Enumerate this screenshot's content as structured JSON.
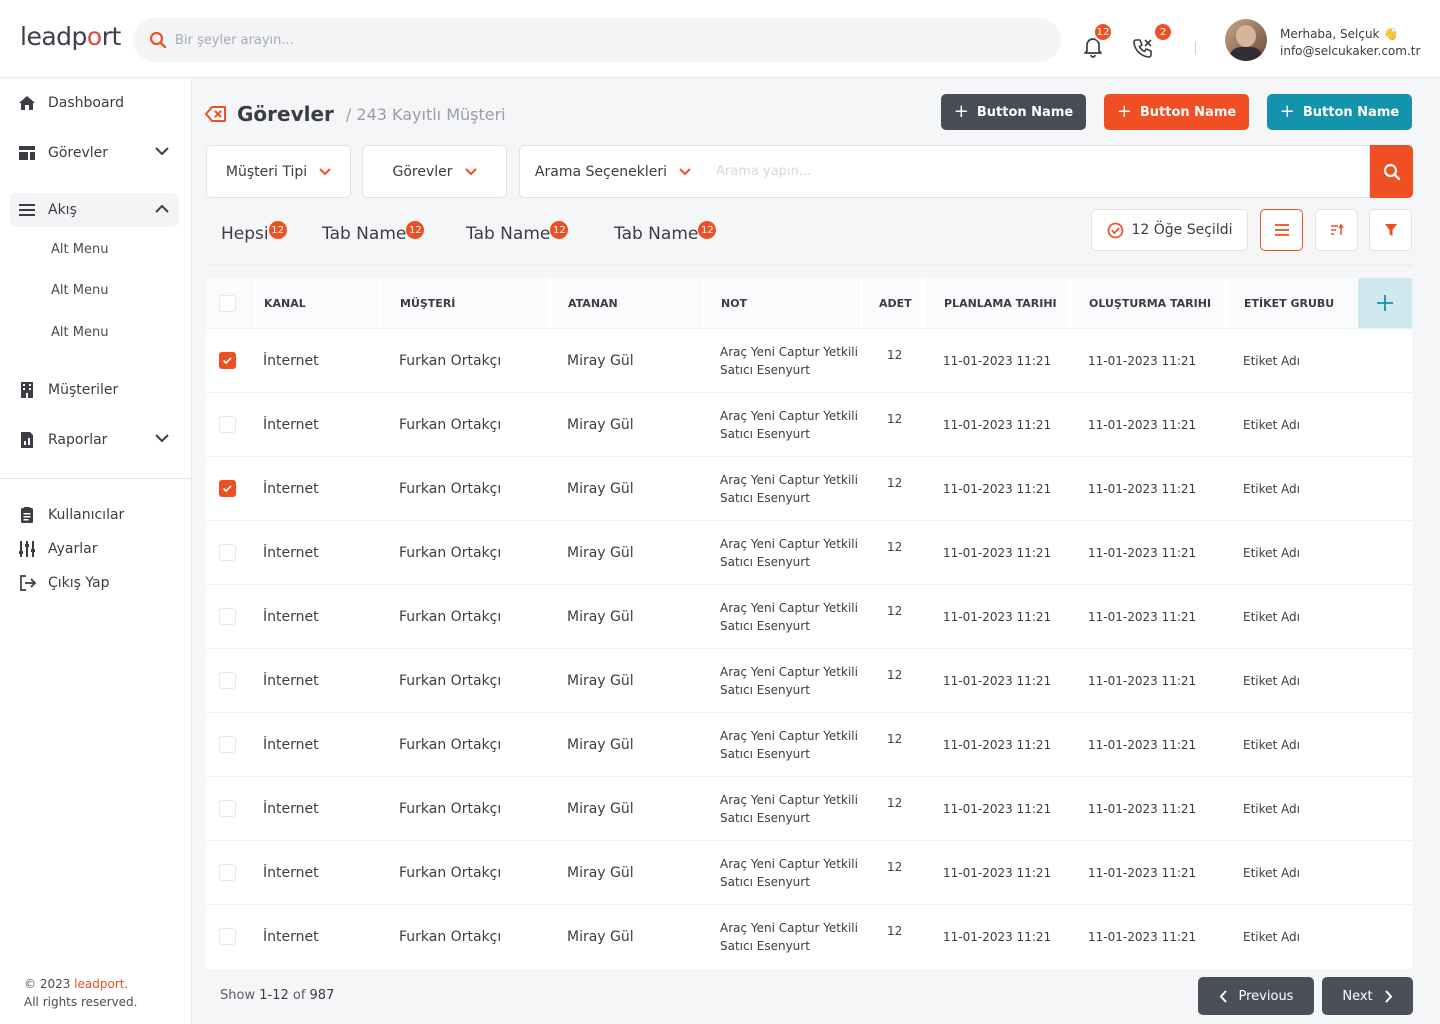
{
  "app": {
    "logo_prefix": "leadp",
    "logo_o": "o",
    "logo_suffix": "rt"
  },
  "search": {
    "placeholder": "Bir şeyler arayın..."
  },
  "notifications": {
    "bell_count": "12",
    "calls_count": "2"
  },
  "user": {
    "greeting": "Merhaba, Selçuk 👋",
    "email": "info@selcukaker.com.tr"
  },
  "sidebar": {
    "items": [
      {
        "label": "Dashboard",
        "icon": "home-icon"
      },
      {
        "label": "Görevler",
        "icon": "layout-icon"
      },
      {
        "label": "Akış",
        "icon": "menu-lines-icon"
      },
      {
        "label": "Müşteriler",
        "icon": "building-icon"
      },
      {
        "label": "Raporlar",
        "icon": "report-icon"
      }
    ],
    "submenu": [
      "Alt Menu",
      "Alt Menu",
      "Alt Menu"
    ],
    "bottom": [
      {
        "label": "Kullanıcılar",
        "icon": "clipboard-icon"
      },
      {
        "label": "Ayarlar",
        "icon": "sliders-icon"
      },
      {
        "label": "Çıkış Yap",
        "icon": "logout-icon"
      }
    ],
    "copyright_prefix": "© 2023 ",
    "copyright_brand": "leadport.",
    "copyright_rights": "All rights reserved."
  },
  "page": {
    "title": "Görevler",
    "subtitle": "/ 243 Kayıtlı Müşteri"
  },
  "actions": [
    {
      "label": "Button Name",
      "color": "#474c57"
    },
    {
      "label": "Button Name",
      "color": "#f04e23"
    },
    {
      "label": "Button Name",
      "color": "#1494ac"
    }
  ],
  "filters": {
    "customer_type": "Müşteri Tipi",
    "tasks": "Görevler",
    "search_options": "Arama Seçenekleri",
    "search_placeholder": "Arama yapın..."
  },
  "tabs": [
    {
      "label": "Hepsi",
      "count": "12"
    },
    {
      "label": "Tab Name",
      "count": "12"
    },
    {
      "label": "Tab Name",
      "count": "12"
    },
    {
      "label": "Tab Name",
      "count": "12"
    }
  ],
  "selection": {
    "label": "12 Öğe Seçildi"
  },
  "table": {
    "columns": [
      "KANAL",
      "MÜŞTERİ",
      "ATANAN",
      "NOT",
      "ADET",
      "PLANLAMA TARIHI",
      "OLUŞTURMA TARIHI",
      "ETİKET GRUBU"
    ],
    "rows": [
      {
        "checked": true,
        "kanal": "İnternet",
        "musteri": "Furkan Ortakçı",
        "atanan": "Miray Gül",
        "not1": "Araç Yeni Captur Yetkili",
        "not2": "Satıcı Esenyurt",
        "adet": "12",
        "plan": "11-01-2023 11:21",
        "olus": "11-01-2023 11:21",
        "etiket": "Etiket Adı"
      },
      {
        "checked": false,
        "kanal": "İnternet",
        "musteri": "Furkan Ortakçı",
        "atanan": "Miray Gül",
        "not1": "Araç Yeni Captur Yetkili",
        "not2": "Satıcı Esenyurt",
        "adet": "12",
        "plan": "11-01-2023 11:21",
        "olus": "11-01-2023 11:21",
        "etiket": "Etiket Adı"
      },
      {
        "checked": true,
        "kanal": "İnternet",
        "musteri": "Furkan Ortakçı",
        "atanan": "Miray Gül",
        "not1": "Araç Yeni Captur Yetkili",
        "not2": "Satıcı Esenyurt",
        "adet": "12",
        "plan": "11-01-2023 11:21",
        "olus": "11-01-2023 11:21",
        "etiket": "Etiket Adı"
      },
      {
        "checked": false,
        "kanal": "İnternet",
        "musteri": "Furkan Ortakçı",
        "atanan": "Miray Gül",
        "not1": "Araç Yeni Captur Yetkili",
        "not2": "Satıcı Esenyurt",
        "adet": "12",
        "plan": "11-01-2023 11:21",
        "olus": "11-01-2023 11:21",
        "etiket": "Etiket Adı"
      },
      {
        "checked": false,
        "kanal": "İnternet",
        "musteri": "Furkan Ortakçı",
        "atanan": "Miray Gül",
        "not1": "Araç Yeni Captur Yetkili",
        "not2": "Satıcı Esenyurt",
        "adet": "12",
        "plan": "11-01-2023 11:21",
        "olus": "11-01-2023 11:21",
        "etiket": "Etiket Adı"
      },
      {
        "checked": false,
        "kanal": "İnternet",
        "musteri": "Furkan Ortakçı",
        "atanan": "Miray Gül",
        "not1": "Araç Yeni Captur Yetkili",
        "not2": "Satıcı Esenyurt",
        "adet": "12",
        "plan": "11-01-2023 11:21",
        "olus": "11-01-2023 11:21",
        "etiket": "Etiket Adı"
      },
      {
        "checked": false,
        "kanal": "İnternet",
        "musteri": "Furkan Ortakçı",
        "atanan": "Miray Gül",
        "not1": "Araç Yeni Captur Yetkili",
        "not2": "Satıcı Esenyurt",
        "adet": "12",
        "plan": "11-01-2023 11:21",
        "olus": "11-01-2023 11:21",
        "etiket": "Etiket Adı"
      },
      {
        "checked": false,
        "kanal": "İnternet",
        "musteri": "Furkan Ortakçı",
        "atanan": "Miray Gül",
        "not1": "Araç Yeni Captur Yetkili",
        "not2": "Satıcı Esenyurt",
        "adet": "12",
        "plan": "11-01-2023 11:21",
        "olus": "11-01-2023 11:21",
        "etiket": "Etiket Adı"
      },
      {
        "checked": false,
        "kanal": "İnternet",
        "musteri": "Furkan Ortakçı",
        "atanan": "Miray Gül",
        "not1": "Araç Yeni Captur Yetkili",
        "not2": "Satıcı Esenyurt",
        "adet": "12",
        "plan": "11-01-2023 11:21",
        "olus": "11-01-2023 11:21",
        "etiket": "Etiket Adı"
      },
      {
        "checked": false,
        "kanal": "İnternet",
        "musteri": "Furkan Ortakçı",
        "atanan": "Miray Gül",
        "not1": "Araç Yeni Captur Yetkili",
        "not2": "Satıcı Esenyurt",
        "adet": "12",
        "plan": "11-01-2023 11:21",
        "olus": "11-01-2023 11:21",
        "etiket": "Etiket Adı"
      }
    ]
  },
  "pagination": {
    "show": "Show ",
    "range": "1-12",
    "of": " of ",
    "total": "987",
    "prev": "Previous",
    "next": "Next"
  },
  "colors": {
    "accent": "#f04e23",
    "teal": "#1494ac",
    "dark": "#474c57"
  }
}
